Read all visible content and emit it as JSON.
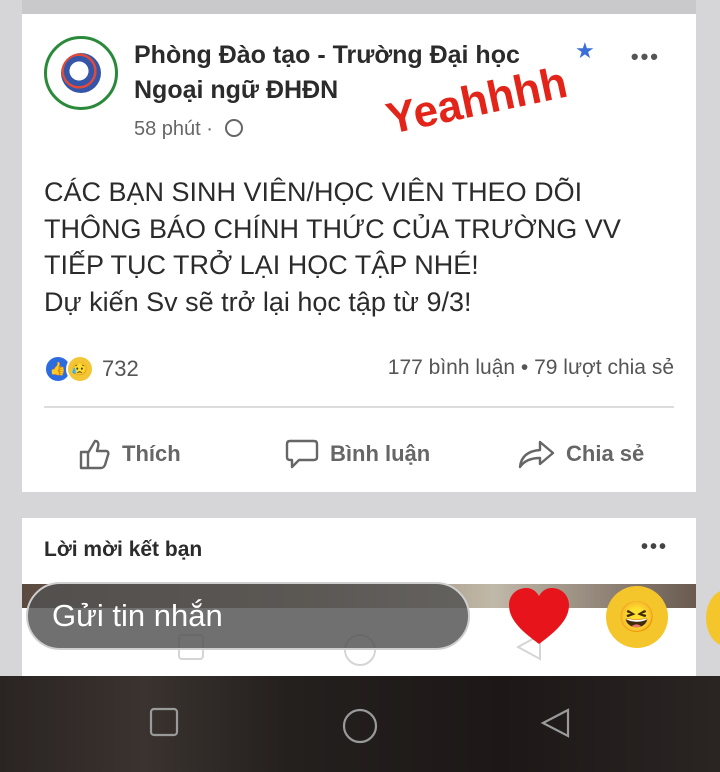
{
  "post": {
    "page_name": "Phòng Đào tạo - Trường Đại học Ngoại ngữ ĐHĐN",
    "time": "58 phút",
    "dot": "·",
    "annotation": "Yeahhhh",
    "lines": [
      "CÁC BẠN SINH VIÊN/HỌC VIÊN THEO DÕI",
      "THÔNG BÁO CHÍNH THỨC CỦA TRƯỜNG VV",
      "TIẾP TỤC TRỞ LẠI HỌC TẬP NHÉ!",
      "Dự kiến Sv sẽ trở lại học tập từ 9/3!"
    ],
    "reaction_count": "732",
    "stats": "177 bình luận • 79 lượt chia sẻ",
    "actions": {
      "like": "Thích",
      "comment": "Bình luận",
      "share": "Chia sẻ"
    }
  },
  "friends": {
    "title": "Lời mời kết bạn"
  },
  "message": {
    "placeholder": "Gửi tin nhắn"
  },
  "colors": {
    "annotation": "#e32419",
    "verified": "#3b6fd8",
    "like": "#2d6be0",
    "heart": "#e8141b"
  },
  "icons": [
    "verified-star-icon",
    "more-icon",
    "globe-icon",
    "like-reaction-icon",
    "sad-reaction-icon",
    "thumbs-up-icon",
    "comment-icon",
    "share-icon",
    "heart-icon",
    "laugh-emoji-icon",
    "nav-back-icon",
    "nav-home-icon",
    "nav-recent-icon"
  ]
}
